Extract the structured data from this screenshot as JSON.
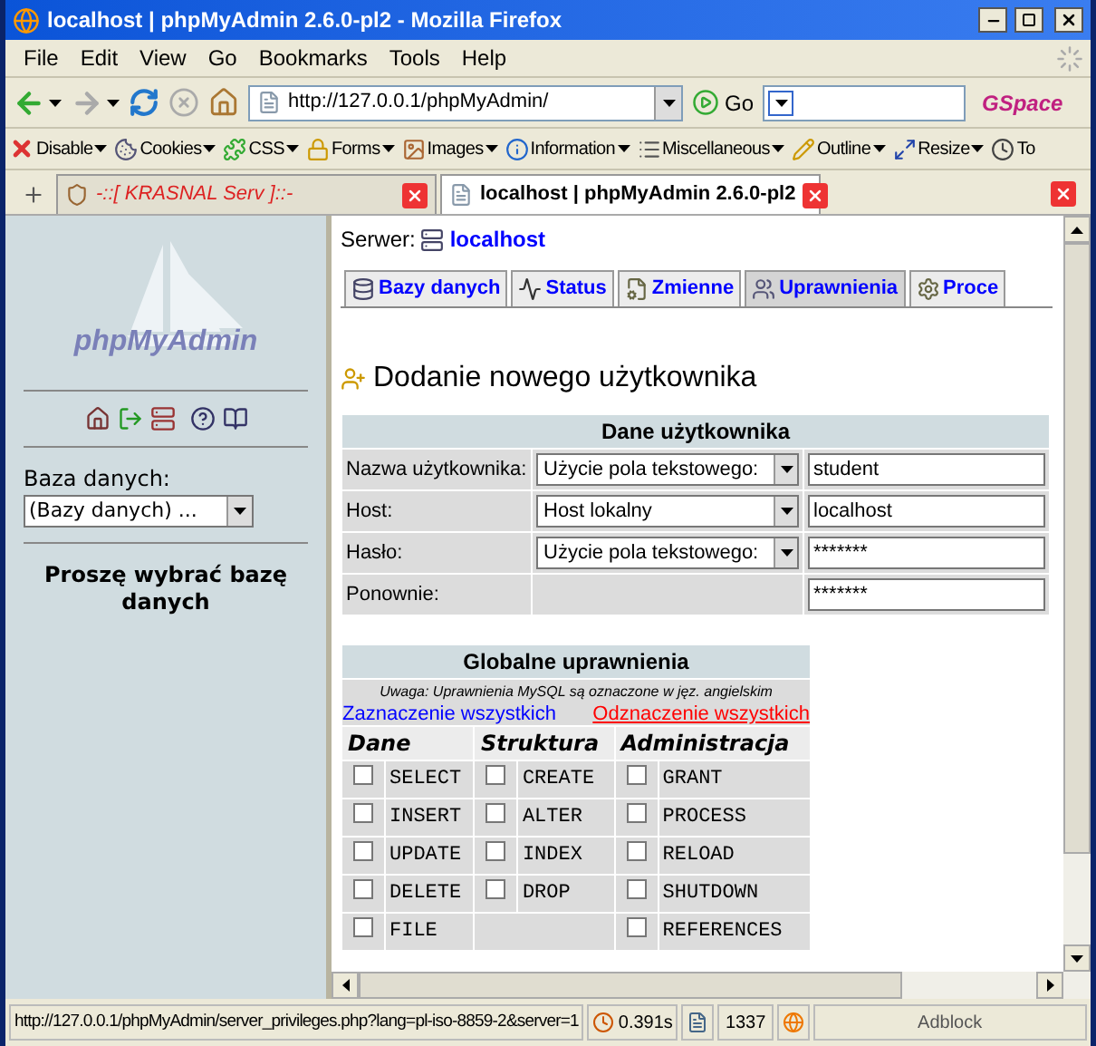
{
  "window": {
    "title": "localhost | phpMyAdmin 2.6.0-pl2 - Mozilla Firefox"
  },
  "menu": [
    "File",
    "Edit",
    "View",
    "Go",
    "Bookmarks",
    "Tools",
    "Help"
  ],
  "navigation": {
    "url": "http://127.0.0.1/phpMyAdmin/",
    "go_label": "Go",
    "brand": "GSpace"
  },
  "extensions": [
    {
      "label": "Disable",
      "dropdown": true
    },
    {
      "label": "Cookies",
      "dropdown": true
    },
    {
      "label": "CSS",
      "dropdown": true
    },
    {
      "label": "Forms",
      "dropdown": true
    },
    {
      "label": "Images",
      "dropdown": true
    },
    {
      "label": "Information",
      "dropdown": true
    },
    {
      "label": "Miscellaneous",
      "dropdown": true
    },
    {
      "label": "Outline",
      "dropdown": true
    },
    {
      "label": "Resize",
      "dropdown": true
    },
    {
      "label": "To",
      "dropdown": false
    }
  ],
  "browser_tabs": [
    {
      "label": "-::[ KRASNAL Serv ]::-",
      "selected": false
    },
    {
      "label": "localhost | phpMyAdmin 2.6.0-pl2",
      "selected": true
    }
  ],
  "sidebar": {
    "logo": "phpMyAdmin",
    "database_label": "Baza danych:",
    "database_select": "(Bazy danych) ...",
    "message": "Proszę wybrać bazę danych"
  },
  "server": {
    "label": "Serwer:",
    "name": "localhost"
  },
  "tabs": [
    {
      "label": "Bazy danych",
      "selected": false
    },
    {
      "label": "Status",
      "selected": false
    },
    {
      "label": "Zmienne",
      "selected": false
    },
    {
      "label": "Uprawnienia",
      "selected": true
    },
    {
      "label": "Proce",
      "selected": false
    }
  ],
  "heading": "Dodanie nowego użytkownika",
  "user_form": {
    "title": "Dane użytkownika",
    "rows": [
      {
        "label": "Nazwa użytkownika:",
        "select": "Użycie pola tekstowego:",
        "value": "student"
      },
      {
        "label": "Host:",
        "select": "Host lokalny",
        "value": "localhost"
      },
      {
        "label": "Hasło:",
        "select": "Użycie pola tekstowego:",
        "value": "*******"
      },
      {
        "label": "Ponownie:",
        "value": "*******"
      }
    ]
  },
  "privileges": {
    "title": "Globalne uprawnienia",
    "note": "Uwaga: Uprawnienia MySQL są oznaczone w jęz. angielskim",
    "select_all": "Zaznaczenie wszystkich",
    "deselect_all": "Odznaczenie wszystkich",
    "groups": [
      {
        "title": "Dane",
        "items": [
          {
            "label": "SELECT",
            "checked": false
          },
          {
            "label": "INSERT",
            "checked": false
          },
          {
            "label": "UPDATE",
            "checked": false
          },
          {
            "label": "DELETE",
            "checked": false
          },
          {
            "label": "FILE",
            "checked": false
          }
        ]
      },
      {
        "title": "Struktura",
        "items": [
          {
            "label": "CREATE",
            "checked": false
          },
          {
            "label": "ALTER",
            "checked": false
          },
          {
            "label": "INDEX",
            "checked": false
          },
          {
            "label": "DROP",
            "checked": false
          }
        ]
      },
      {
        "title": "Administracja",
        "items": [
          {
            "label": "GRANT",
            "checked": false
          },
          {
            "label": "PROCESS",
            "checked": false
          },
          {
            "label": "RELOAD",
            "checked": false
          },
          {
            "label": "SHUTDOWN",
            "checked": false
          },
          {
            "label": "REFERENCES",
            "checked": false
          }
        ]
      }
    ]
  },
  "status_bar": {
    "url": "http://127.0.0.1/phpMyAdmin/server_privileges.php?lang=pl-iso-8859-2&server=1",
    "timer": "0.391s",
    "counter": "1337",
    "adblock": "Adblock"
  }
}
